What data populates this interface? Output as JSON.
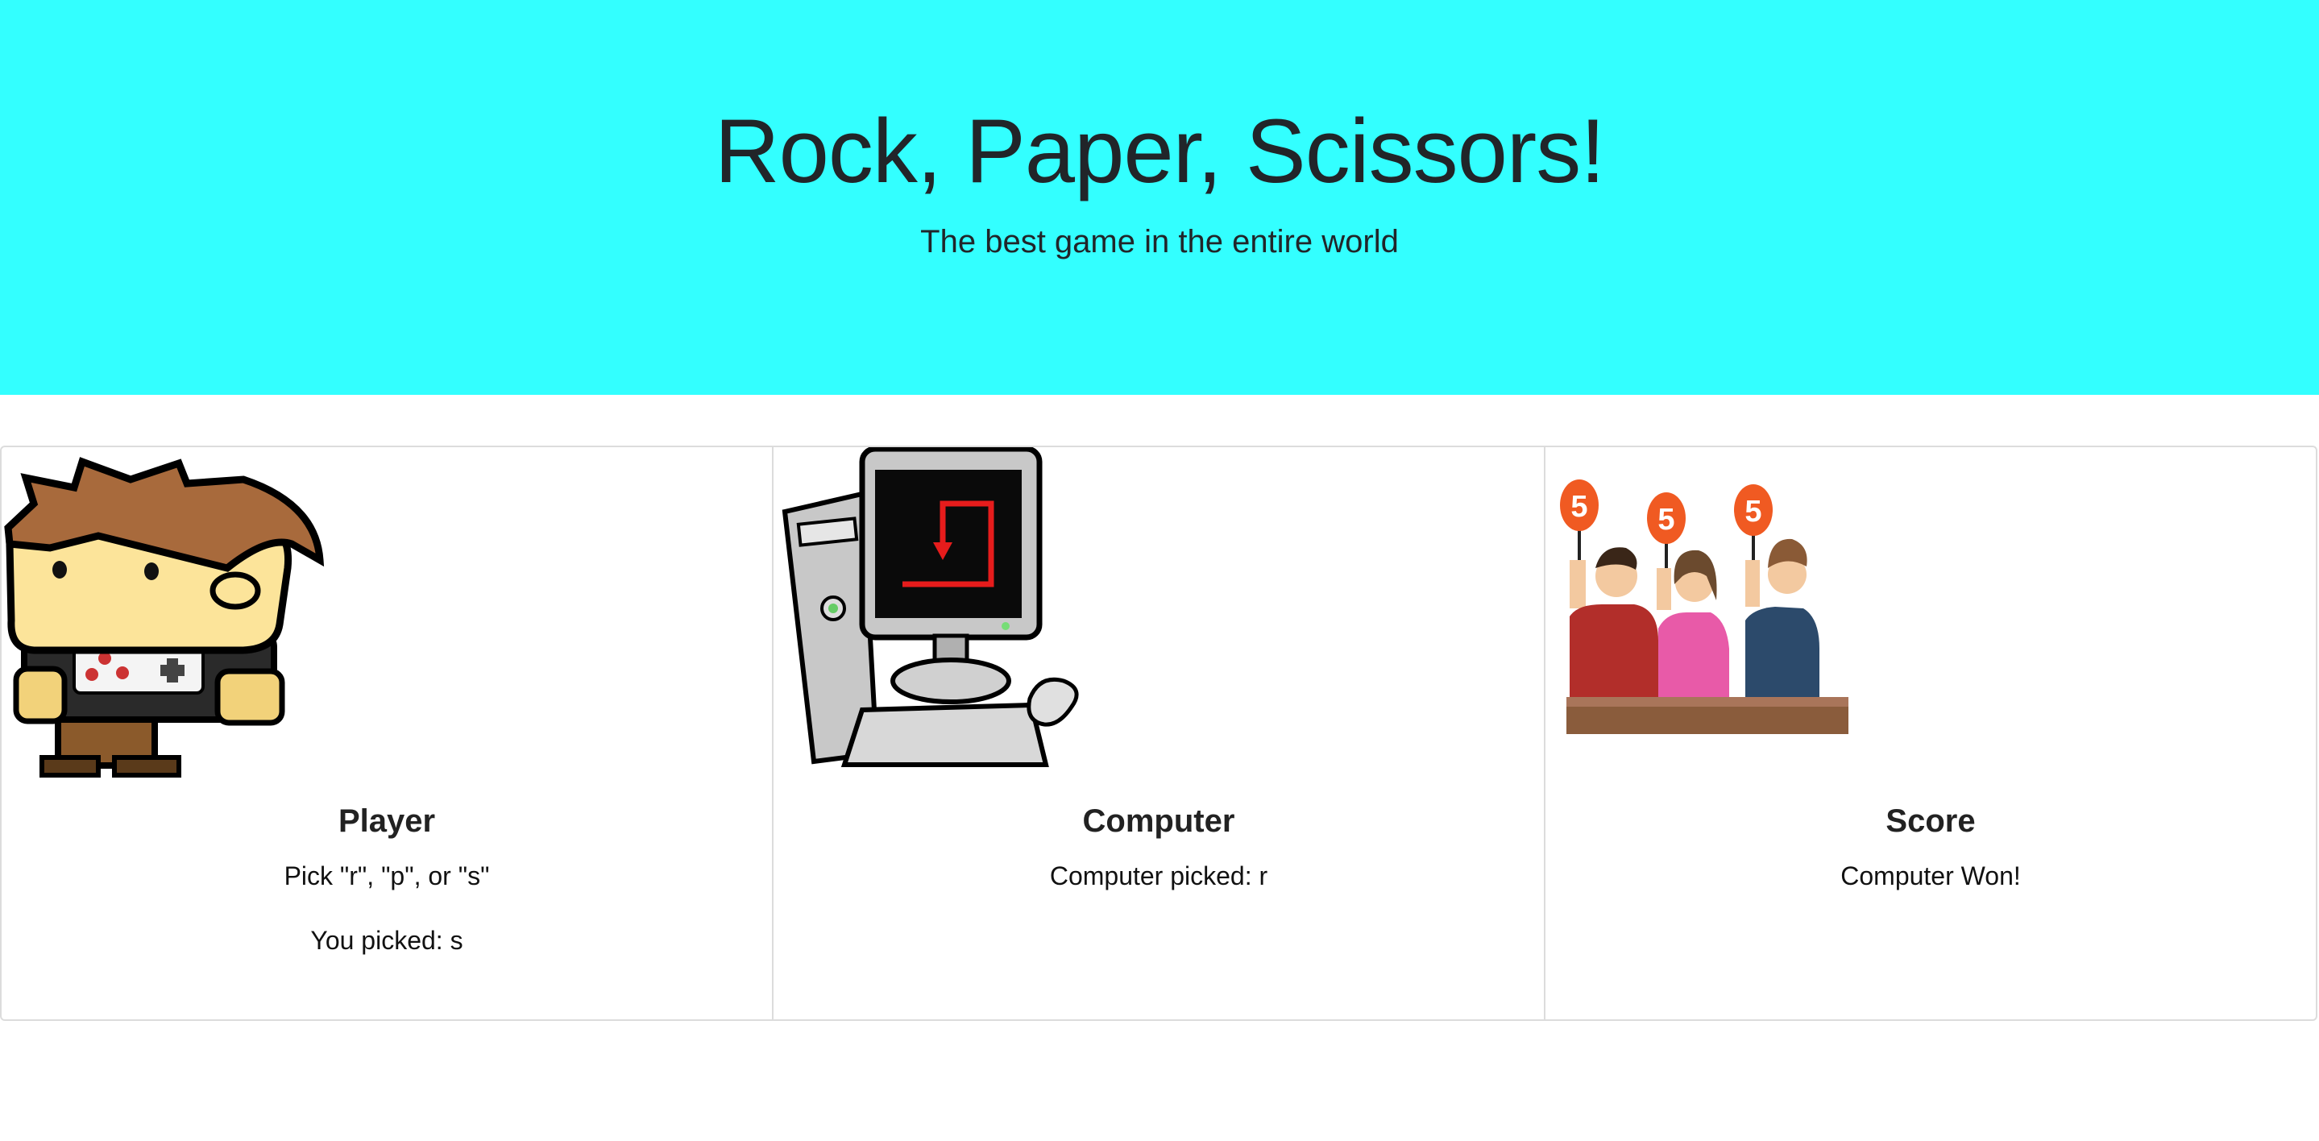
{
  "header": {
    "title": "Rock, Paper, Scissors!",
    "subtitle": "The best game in the entire world"
  },
  "cards": {
    "player": {
      "title": "Player",
      "instruction": "Pick \"r\", \"p\", or \"s\"",
      "result": "You picked: s",
      "image_icon": "cartoon-boy-icon"
    },
    "computer": {
      "title": "Computer",
      "result": "Computer picked: r",
      "image_icon": "desktop-computer-icon"
    },
    "score": {
      "title": "Score",
      "result": "Computer Won!",
      "image_icon": "judges-scorecards-icon"
    }
  },
  "colors": {
    "header_background": "#33ffff",
    "card_border": "#dcdcdc",
    "text": "#212529"
  }
}
